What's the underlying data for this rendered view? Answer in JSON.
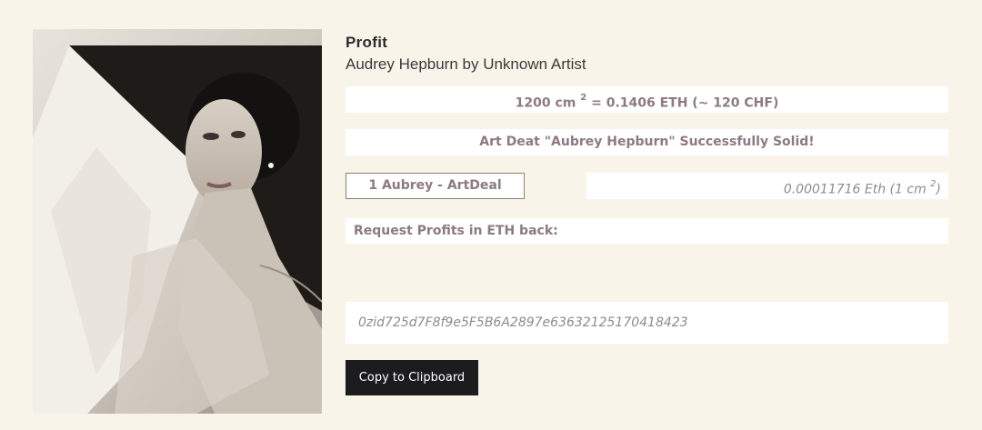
{
  "artwork": {
    "title": "Profit",
    "subtitle": "Audrey Hepburn by Unknown Artist",
    "image_icon": "portrait-photo"
  },
  "conversion": {
    "area_prefix": "1200 cm ",
    "area_exponent": "2",
    "rest": " = 0.1406 ETH (~ 120 CHF)"
  },
  "status": {
    "message": "Art Deat \"Aubrey Hepburn\" Successfully Solid!"
  },
  "token": {
    "label": "1 Aubrey - ArtDeal",
    "price_prefix": "0.00011716 Eth (1 cm ",
    "price_exponent": "2",
    "price_suffix": ")"
  },
  "request": {
    "label": "Request Profits in ETH back:"
  },
  "wallet": {
    "address": "0zid725d7F8f9e5F5B6A2897e63632125170418423"
  },
  "actions": {
    "copy_label": "Copy to Clipboard"
  },
  "colors": {
    "background": "#f8f4ea",
    "accent_text": "#8c7a82",
    "button_bg": "#1c1c1e"
  }
}
